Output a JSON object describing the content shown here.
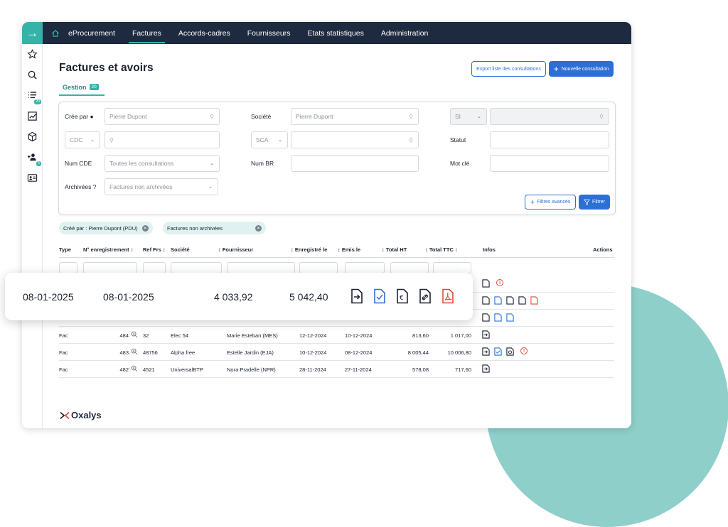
{
  "nav": {
    "home_icon": "home-icon",
    "items": [
      {
        "label": "eProcurement",
        "active": false
      },
      {
        "label": "Factures",
        "active": true
      },
      {
        "label": "Accords-cadres",
        "active": false
      },
      {
        "label": "Fournisseurs",
        "active": false
      },
      {
        "label": "Etats statistiques",
        "active": false
      },
      {
        "label": "Administration",
        "active": false
      }
    ]
  },
  "sidebar": {
    "icons": [
      "arrow-right-icon",
      "star-icon",
      "search-icon",
      "list-icon",
      "chart-icon",
      "cube-icon",
      "user-add-icon",
      "id-card-icon"
    ],
    "list_badge": "20",
    "user_badge": "5"
  },
  "page": {
    "title": "Factures et avoirs",
    "export_button": "Export liste des consultations",
    "new_button": "Nouvelle consultation",
    "tab_label": "Gestion",
    "tab_count": "20"
  },
  "filters": {
    "cree_par_label": "Crée par",
    "cree_par_value": "Pierre Dupont",
    "societe_label": "Société",
    "societe_value": "Pierre Dupont",
    "si_select": "SI",
    "cdc_select": "CDC",
    "sca_select": "SCA",
    "statut_label": "Statut",
    "num_cde_label": "Num CDE",
    "num_cde_value": "Toutes les consultations",
    "num_br_label": "Num BR",
    "mot_cle_label": "Mot clé",
    "archivees_label": "Archivées ?",
    "archivees_value": "Factures non archivées",
    "advanced_button": "Filtres avancés",
    "filter_button": "Filtrer"
  },
  "chips": [
    {
      "label": "Créé par : Pierre Dupont (PDU)"
    },
    {
      "label": "Factures non archivées"
    }
  ],
  "table": {
    "headers": [
      "Type",
      "N° enregistrement",
      "Ref Frs",
      "Société",
      "Fournisseur",
      "Enregistré le",
      "Emis le",
      "Total HT",
      "Total TTC",
      "Infos",
      "Actions"
    ],
    "rows": [
      {
        "type": "Fac",
        "num": "484",
        "ref": "32",
        "societe": "Elec 54",
        "fournisseur": "Marie Esteban (MES)",
        "enregistre": "12-12-2024",
        "emis": "10-12-2024",
        "ht": "813,60",
        "ttc": "1 017,00"
      },
      {
        "type": "Fac",
        "num": "483",
        "ref": "48756",
        "societe": "Alpha free",
        "fournisseur": "Estelle Jardin (EJA)",
        "enregistre": "10-12-2024",
        "emis": "08-12-2024",
        "ht": "8 005,44",
        "ttc": "10 006,80"
      },
      {
        "type": "Fac",
        "num": "482",
        "ref": "4521",
        "societe": "UniversalBTP",
        "fournisseur": "Nora Pradelle (NPR)",
        "enregistre": "28-11-2024",
        "emis": "27-11-2024",
        "ht": "578,08",
        "ttc": "717,60"
      }
    ]
  },
  "callout": {
    "date1": "08-01-2025",
    "date2": "08-01-2025",
    "ht": "4 033,92",
    "ttc": "5 042,40",
    "icons": [
      "doc-arrow-icon",
      "doc-check-icon",
      "doc-euro-icon",
      "doc-link-icon",
      "pdf-icon"
    ]
  },
  "logo": {
    "text": "Oxalys"
  },
  "colors": {
    "teal": "#36b3a8",
    "navy": "#1e2a3f",
    "blue": "#2c6fd6",
    "red": "#e04b3c",
    "circle": "#8ecfca"
  }
}
